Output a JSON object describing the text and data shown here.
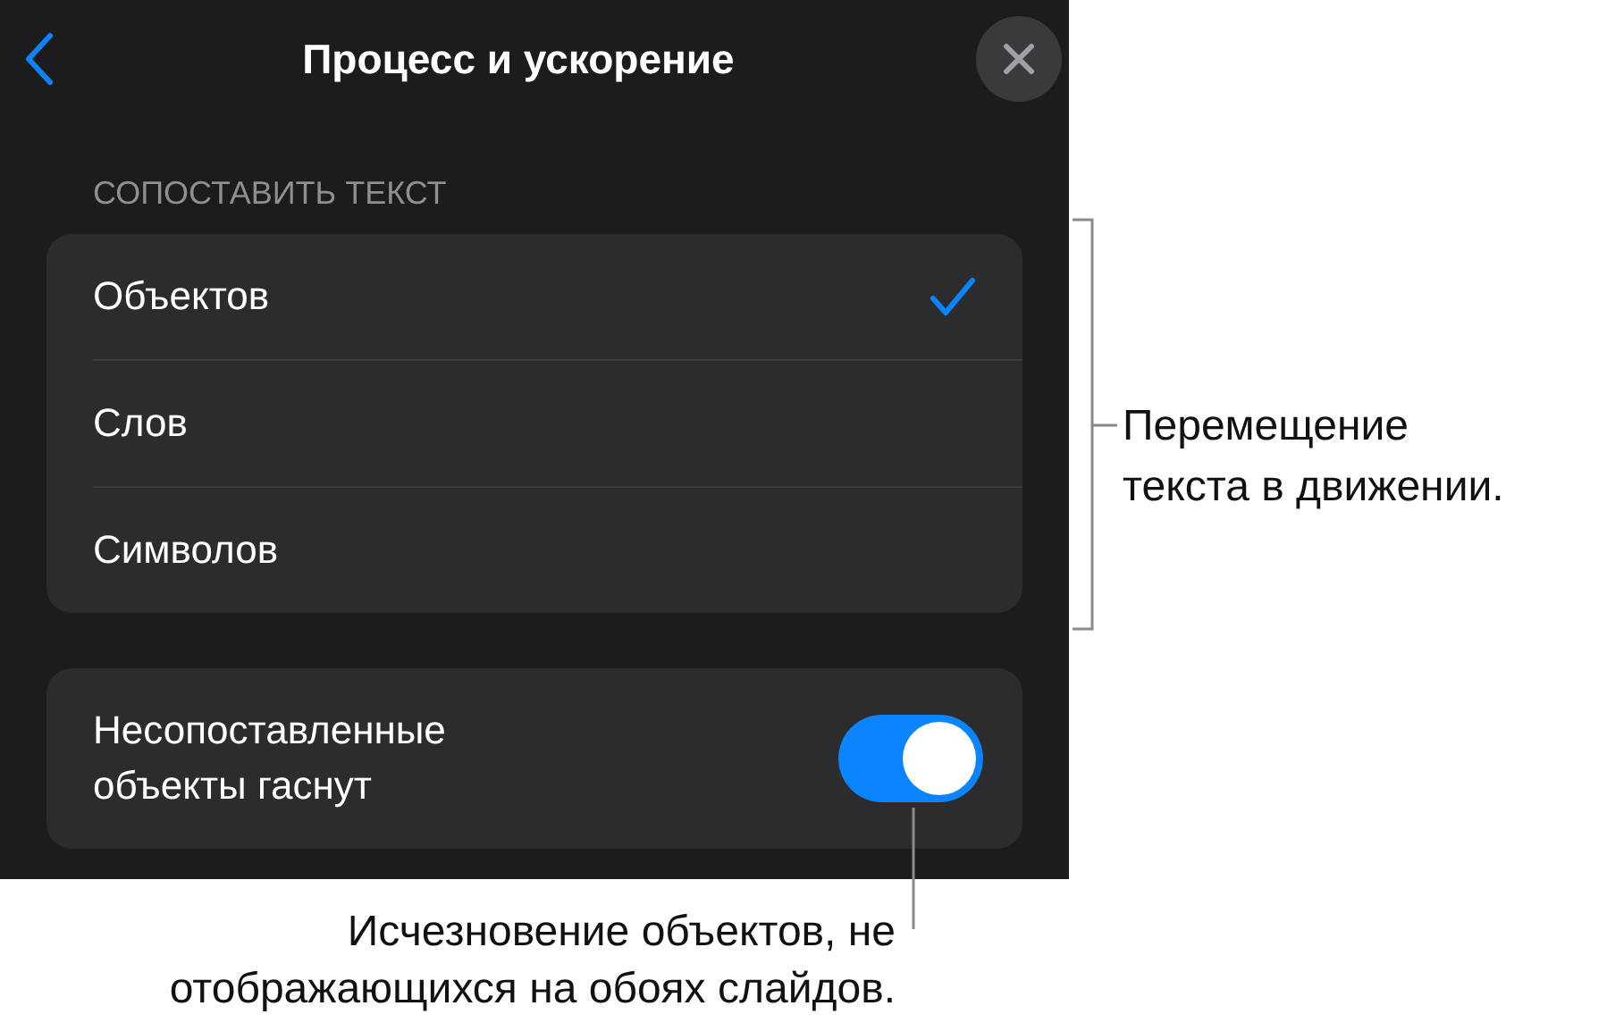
{
  "header": {
    "title": "Процесс и ускорение"
  },
  "section": {
    "label": "СОПОСТАВИТЬ ТЕКСТ",
    "options": [
      {
        "label": "Объектов",
        "selected": true
      },
      {
        "label": "Слов",
        "selected": false
      },
      {
        "label": "Символов",
        "selected": false
      }
    ]
  },
  "fade_toggle": {
    "label": "Несопоставленные объекты гаснут",
    "on": true
  },
  "callouts": [
    {
      "text": "Перемещение\nтекста в движении."
    },
    {
      "text": "Исчезновение объектов, не\nотображающихся на обоях слайдов."
    }
  ]
}
